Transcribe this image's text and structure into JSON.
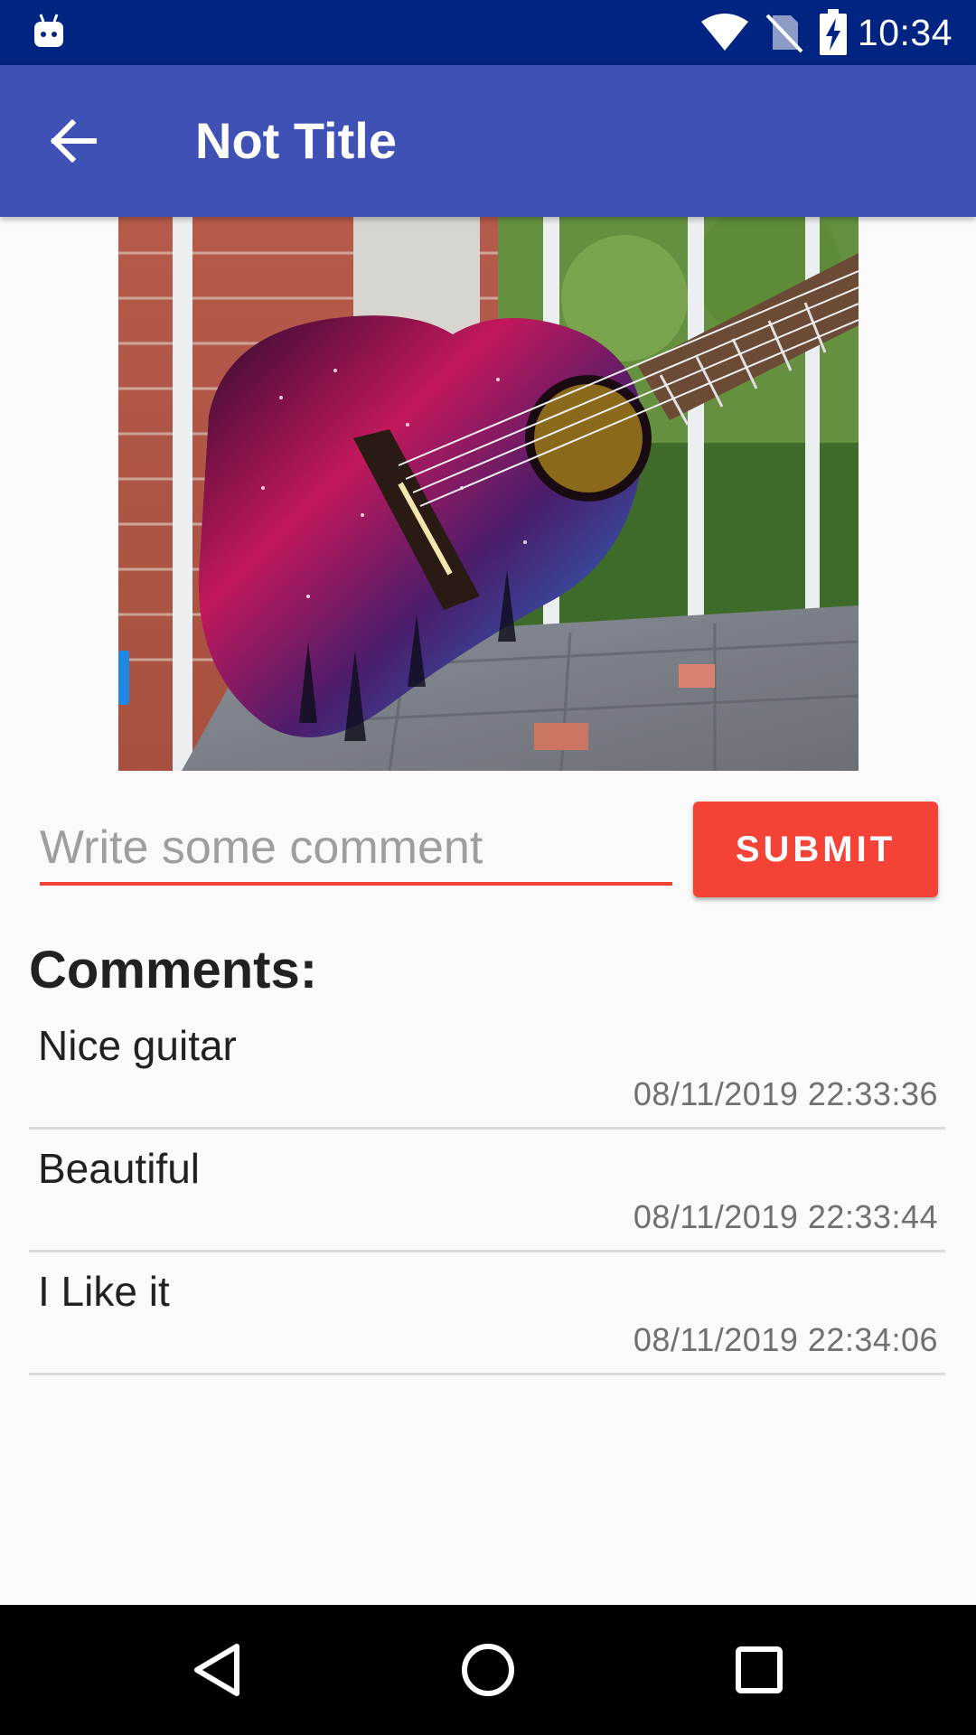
{
  "status_bar": {
    "time": "10:34",
    "icons": [
      "android-debug-icon",
      "wifi-icon",
      "no-sim-icon",
      "battery-charging-icon"
    ]
  },
  "toolbar": {
    "title": "Not Title",
    "back_icon": "arrow-back-icon"
  },
  "photo": {
    "subject": "painted galaxy ukulele"
  },
  "comment_form": {
    "input_value": "",
    "placeholder": "Write some comment",
    "submit_label": "SUBMIT"
  },
  "comments": {
    "heading": "Comments:",
    "items": [
      {
        "text": "Nice guitar",
        "timestamp": "08/11/2019 22:33:36"
      },
      {
        "text": "Beautiful",
        "timestamp": "08/11/2019 22:33:44"
      },
      {
        "text": "I Like it",
        "timestamp": "08/11/2019 22:34:06"
      }
    ]
  },
  "nav_bar": {
    "buttons": [
      "back-triangle-icon",
      "home-circle-icon",
      "recents-square-icon"
    ]
  },
  "colors": {
    "status_bar": "#002482",
    "toolbar": "#3f51b5",
    "accent": "#f44336",
    "background": "#fafafa"
  }
}
